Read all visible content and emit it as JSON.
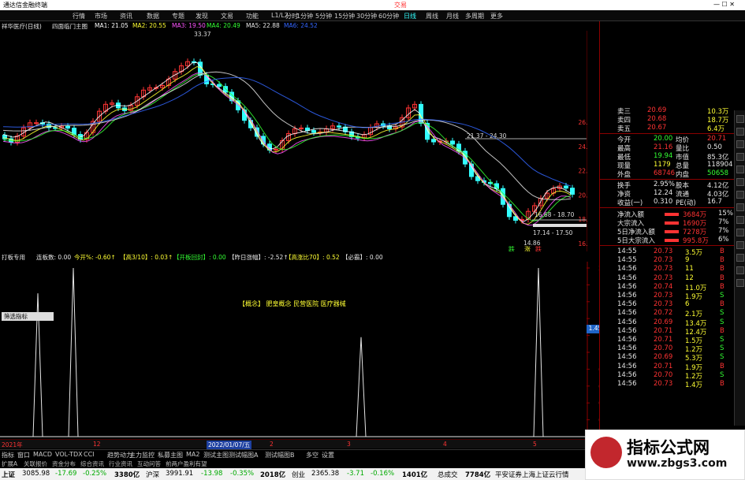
{
  "window": {
    "title": "通达信金融终端",
    "menus": [
      "行情",
      "市场",
      "资讯",
      "数据",
      "专题",
      "发现",
      "文易",
      "功能",
      "L1/L2"
    ],
    "trade_button": "交易"
  },
  "period_tabs": [
    "分时",
    "1分钟",
    "5分钟",
    "15分钟",
    "30分钟",
    "60分钟",
    "日线",
    "周线",
    "月线",
    "多周期",
    "更多"
  ],
  "main": {
    "stock_name": "祥华医疗(日线)",
    "indicator": "四面临门主图",
    "ma": [
      {
        "label": "MA1: 21.05",
        "color": "#ffffff"
      },
      {
        "label": "MA2: 20.55",
        "color": "#ffff33"
      },
      {
        "label": "MA3: 19.50",
        "color": "#ff55ff"
      },
      {
        "label": "MA4: 20.49",
        "color": "#33ff33"
      },
      {
        "label": "MA5: 22.88",
        "color": "#e6e6e6"
      },
      {
        "label": "MA6: 24.52",
        "color": "#3366ff"
      }
    ],
    "price_axis": [
      "26.00",
      "24.00",
      "22.00",
      "20.00",
      "18.00",
      "16.00"
    ],
    "annotations": {
      "high": "33.37",
      "range1": "21.37 - 24.30",
      "range2": "16.68 - 18.70",
      "range3": "17.14 - 17.50",
      "low": "14.86",
      "sig1": "跌",
      "sig2": "涨",
      "sig3": "跌"
    }
  },
  "ind_bar": {
    "name": "打板专用",
    "items": [
      {
        "label": "连板数: 0.00",
        "color": "#e6e6e6"
      },
      {
        "label": "今开%: -0.60↑",
        "color": "#ffff33"
      },
      {
        "label": "【高3/10】: 0.03↑",
        "color": "#ffff33"
      },
      {
        "label": "【开板回封】: 0.00",
        "color": "#33ff33"
      },
      {
        "label": "【昨日涨幅】: -2.52↑",
        "color": "#e6e6e6"
      },
      {
        "label": "【高涨比70】: 0.52",
        "color": "#ffff33"
      },
      {
        "label": "【必霸】: 0.00",
        "color": "#e6e6e6"
      }
    ]
  },
  "sub": {
    "concept": "【概念】 肥皇概念 民营医院 医疗器械",
    "left_button": "筛选指标",
    "axis": [
      "2.00",
      "1.80",
      "1.60",
      "1.40",
      "1.20",
      "1.00",
      "0.80",
      "0.60",
      "0.40",
      "0.20",
      "0.00"
    ],
    "current_marker": "1.45",
    "spikes": [
      0.85,
      0.96,
      1.0,
      0.59,
      1.0
    ]
  },
  "quote": {
    "asks": [
      {
        "label": "卖三",
        "price": "20.69",
        "vol": "10.3万"
      },
      {
        "label": "卖四",
        "price": "20.68",
        "vol": "18.7万"
      },
      {
        "label": "卖五",
        "price": "20.67",
        "vol": "6.4万"
      }
    ],
    "stats": [
      {
        "l1": "今开",
        "v1": "20.00",
        "l2": "均价",
        "v2": "20.71",
        "c1": "#33ff33",
        "c2": "#ff3333"
      },
      {
        "l1": "最高",
        "v1": "21.16",
        "l2": "量比",
        "v2": "0.50",
        "c1": "#ff3333",
        "c2": "#e6e6e6"
      },
      {
        "l1": "最低",
        "v1": "19.94",
        "l2": "市值",
        "v2": "85.3亿",
        "c1": "#33ff33",
        "c2": "#e6e6e6"
      },
      {
        "l1": "现量",
        "v1": "1179",
        "l2": "总量",
        "v2": "118904",
        "c1": "#ffff33",
        "c2": "#e6e6e6"
      },
      {
        "l1": "外盘",
        "v1": "68746",
        "l2": "内盘",
        "v2": "50658",
        "c1": "#ff3333",
        "c2": "#33ff33"
      },
      {
        "l1": "换手",
        "v1": "2.95%",
        "l2": "股本",
        "v2": "4.12亿",
        "c1": "#e6e6e6",
        "c2": "#e6e6e6"
      },
      {
        "l1": "净资",
        "v1": "12.24",
        "l2": "流通",
        "v2": "4.03亿",
        "c1": "#e6e6e6",
        "c2": "#e6e6e6"
      },
      {
        "l1": "收益(一)",
        "v1": "0.310",
        "l2": "PE(动)",
        "v2": "16.7",
        "c1": "#e6e6e6",
        "c2": "#e6e6e6"
      }
    ],
    "flows": [
      {
        "label": "净流入额",
        "value": "3684万",
        "extra": "15%",
        "color": "#ff3333"
      },
      {
        "label": "大宗流入",
        "value": "1690万",
        "extra": "7%",
        "color": "#ff3333"
      },
      {
        "label": "5日净流入额",
        "value": "7278万",
        "extra": "7%",
        "color": "#ff3333"
      },
      {
        "label": "5日大宗流入",
        "value": "995.8万",
        "extra": "6%",
        "color": "#ff3333"
      }
    ],
    "ticks": [
      {
        "t": "14:55",
        "p": "20.73",
        "v": "3.5万",
        "d": "B"
      },
      {
        "t": "14:55",
        "p": "20.73",
        "v": "9",
        "d": "B"
      },
      {
        "t": "14:56",
        "p": "20.73",
        "v": "11",
        "d": "B"
      },
      {
        "t": "14:56",
        "p": "20.73",
        "v": "12",
        "d": "B"
      },
      {
        "t": "14:56",
        "p": "20.74",
        "v": "11.0万",
        "d": "B"
      },
      {
        "t": "14:56",
        "p": "20.73",
        "v": "1.9万",
        "d": "S"
      },
      {
        "t": "14:56",
        "p": "20.73",
        "v": "6",
        "d": "B"
      },
      {
        "t": "14:56",
        "p": "20.72",
        "v": "2.1万",
        "d": "S"
      },
      {
        "t": "14:56",
        "p": "20.69",
        "v": "13.4万",
        "d": "S"
      },
      {
        "t": "14:56",
        "p": "20.71",
        "v": "12.4万",
        "d": "B"
      },
      {
        "t": "14:56",
        "p": "20.71",
        "v": "1.5万",
        "d": "S"
      },
      {
        "t": "14:56",
        "p": "20.70",
        "v": "1.2万",
        "d": "S"
      },
      {
        "t": "14:56",
        "p": "20.69",
        "v": "5.3万",
        "d": "S"
      },
      {
        "t": "14:56",
        "p": "20.71",
        "v": "1.9万",
        "d": "B"
      },
      {
        "t": "14:56",
        "p": "20.70",
        "v": "1.2万",
        "d": "S"
      },
      {
        "t": "14:56",
        "p": "20.73",
        "v": "1.4万",
        "d": "B"
      }
    ]
  },
  "date_axis": [
    "2021年",
    "12",
    "2022/01/07/五",
    "2",
    "3",
    "4",
    "5"
  ],
  "indicator_tabs": [
    "指标",
    "窗口",
    "MACD",
    "VOL-TDX",
    "CCI",
    "趋势动力",
    "主力监控",
    "私募主图",
    "MA2",
    "测试主图",
    "测试幅图A",
    "测试幅图B",
    "多空",
    "设置"
  ],
  "extend_tabs": [
    "扩展A",
    "关联报价",
    "资金分布",
    "综合资讯",
    "行业资讯",
    "互动问答",
    "前两户盈利有望"
  ],
  "status": {
    "sh_label": "上证",
    "sh": "3085.98",
    "sh_chg": "-17.69",
    "sh_pct": "-0.25%",
    "sh_amt": "3380亿",
    "sz_label": "沪深",
    "sz": "3991.91",
    "sz_chg": "-13.98",
    "sz_pct": "-0.35%",
    "sz_amt": "2018亿",
    "cy_label": "创业",
    "cy": "2365.38",
    "cy_chg": "-3.71",
    "cy_pct": "-0.16%",
    "cy_amt": "1401亿",
    "total_label": "总成交",
    "total": "7784亿",
    "broker": "平安证券上海上证云行情"
  },
  "watermark": {
    "line1": "指标公式网",
    "line2": "www.zbgs3.com"
  }
}
